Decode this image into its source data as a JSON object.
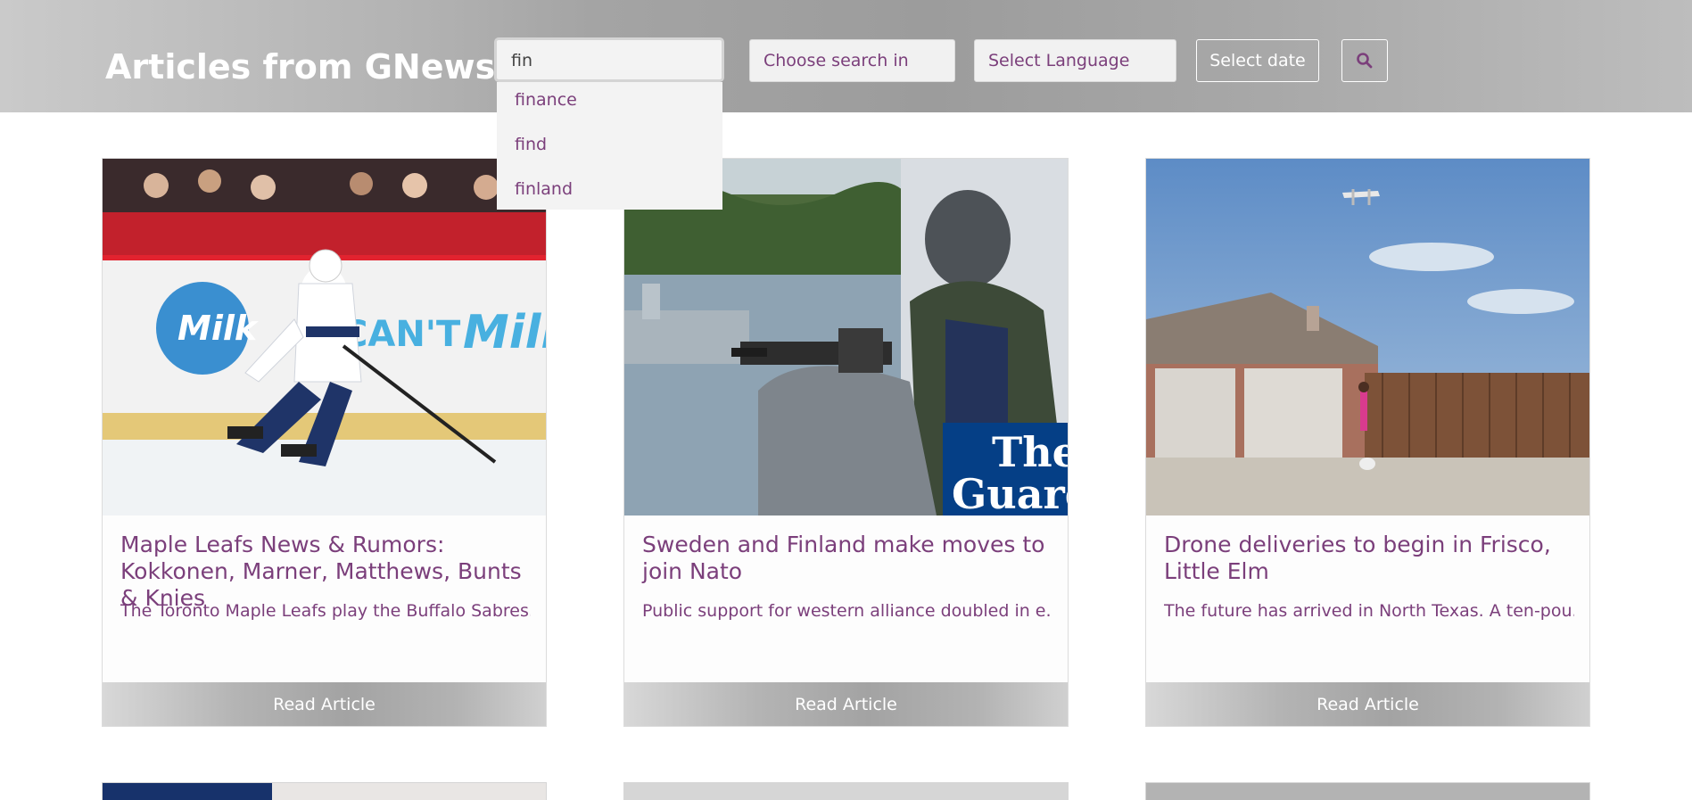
{
  "header": {
    "title": "Articles from GNews",
    "search_value": "fin",
    "suggestions": [
      "finance",
      "find",
      "finland"
    ],
    "search_in_placeholder": "Choose search in",
    "language_placeholder": "Select Language",
    "date_button": "Select date",
    "search_icon": "search-icon"
  },
  "colors": {
    "accent": "#7b3f7b",
    "header_gray": "#a4a4a4"
  },
  "articles": [
    {
      "title": "Maple Leafs News & Rumors: Kokkonen, Marner, Matthews, Bunts & Knies",
      "description": "The Toronto Maple Leafs play the Buffalo Sabres...",
      "button": "Read Article",
      "image_text_1": "CAN'T",
      "image_text_2": "Milk"
    },
    {
      "title": "Sweden and Finland make moves to join Nato",
      "description": "Public support for western alliance doubled in e...",
      "button": "Read Article",
      "image_text_1": "The",
      "image_text_2": "Guard"
    },
    {
      "title": "Drone deliveries to begin in Frisco, Little Elm",
      "description": "The future has arrived in North Texas. A ten-pou...",
      "button": "Read Article"
    }
  ]
}
